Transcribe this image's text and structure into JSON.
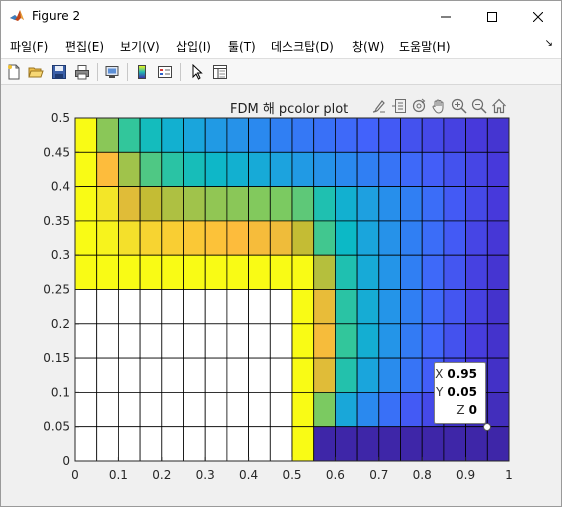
{
  "window": {
    "title": "Figure 2",
    "icon": "matlab-icon",
    "controls": [
      "minimize-icon",
      "maximize-icon",
      "close-icon"
    ]
  },
  "menubar": {
    "items": [
      {
        "label": "파일(F)"
      },
      {
        "label": "편집(E)"
      },
      {
        "label": "보기(V)"
      },
      {
        "label": "삽입(I)"
      },
      {
        "label": "툴(T)"
      },
      {
        "label": "데스크탑(D)"
      },
      {
        "label": "창(W)"
      },
      {
        "label": "도움말(H)"
      }
    ],
    "overflow_icon": "menu-overflow-arrow-icon"
  },
  "toolbar": {
    "buttons": [
      "new-figure-icon",
      "open-file-icon",
      "save-icon",
      "print-icon",
      "link-plot-icon",
      "insert-colorbar-icon",
      "insert-legend-icon",
      "edit-plot-pointer-icon",
      "property-inspector-icon"
    ]
  },
  "axes": {
    "title": "FDM 해 pcolor plot",
    "toolbar": [
      "brush-icon",
      "data-tip-icon",
      "rotate-icon",
      "pan-icon",
      "zoom-in-icon",
      "zoom-out-icon",
      "home-icon"
    ]
  },
  "chart_data": {
    "type": "heatmap",
    "title": "FDM 해 pcolor plot",
    "xlabel": "",
    "ylabel": "",
    "xlim": [
      0,
      1
    ],
    "ylim": [
      0,
      0.5
    ],
    "xticks": [
      "0",
      "0.1",
      "0.2",
      "0.3",
      "0.4",
      "0.5",
      "0.6",
      "0.7",
      "0.8",
      "0.9",
      "1"
    ],
    "yticks": [
      "0",
      "0.05",
      "0.1",
      "0.15",
      "0.2",
      "0.25",
      "0.3",
      "0.35",
      "0.4",
      "0.45",
      "0.5"
    ],
    "grid_step": 0.05,
    "rows_description": "rows listed from top (y=0.45..0.5) to bottom (y=0..0.05); columns from x=0..0.05 to x=0.95..1; null = NaN (white)",
    "z": [
      [
        1.0,
        0.72,
        0.6,
        0.52,
        0.46,
        0.41,
        0.37,
        0.34,
        0.31,
        0.28,
        0.26,
        0.24,
        0.22,
        0.2,
        0.18,
        0.16,
        0.14,
        0.12,
        0.1,
        0.08
      ],
      [
        1.0,
        0.88,
        0.75,
        0.64,
        0.58,
        0.53,
        0.49,
        0.46,
        0.43,
        0.4,
        0.37,
        0.34,
        0.31,
        0.28,
        0.25,
        0.22,
        0.19,
        0.16,
        0.13,
        0.1
      ],
      [
        1.0,
        0.95,
        0.84,
        0.8,
        0.77,
        0.75,
        0.73,
        0.72,
        0.71,
        0.7,
        0.66,
        0.55,
        0.46,
        0.39,
        0.33,
        0.28,
        0.23,
        0.18,
        0.14,
        0.1
      ],
      [
        1.0,
        0.98,
        0.94,
        0.92,
        0.91,
        0.9,
        0.89,
        0.88,
        0.87,
        0.86,
        0.8,
        0.62,
        0.5,
        0.41,
        0.34,
        0.28,
        0.23,
        0.18,
        0.13,
        0.09
      ],
      [
        1.0,
        1.0,
        1.0,
        1.0,
        1.0,
        1.0,
        1.0,
        1.0,
        1.0,
        1.0,
        1.0,
        0.78,
        0.55,
        0.43,
        0.35,
        0.28,
        0.22,
        0.17,
        0.12,
        0.08
      ],
      [
        null,
        null,
        null,
        null,
        null,
        null,
        null,
        null,
        null,
        null,
        1.0,
        0.85,
        0.58,
        0.44,
        0.35,
        0.28,
        0.22,
        0.17,
        0.12,
        0.07
      ],
      [
        null,
        null,
        null,
        null,
        null,
        null,
        null,
        null,
        null,
        null,
        1.0,
        0.87,
        0.6,
        0.45,
        0.35,
        0.27,
        0.21,
        0.16,
        0.11,
        0.07
      ],
      [
        null,
        null,
        null,
        null,
        null,
        null,
        null,
        null,
        null,
        null,
        1.0,
        0.84,
        0.56,
        0.41,
        0.32,
        0.25,
        0.19,
        0.14,
        0.1,
        0.06
      ],
      [
        null,
        null,
        null,
        null,
        null,
        null,
        null,
        null,
        null,
        null,
        1.0,
        0.7,
        0.42,
        0.31,
        0.24,
        0.18,
        0.14,
        0.1,
        0.07,
        0.04
      ],
      [
        null,
        null,
        null,
        null,
        null,
        null,
        null,
        null,
        null,
        null,
        1.0,
        0.0,
        0.0,
        0.0,
        0.0,
        0.0,
        0.0,
        0.0,
        0.0,
        0.0
      ]
    ],
    "colormap": "parula",
    "clim": [
      0,
      1
    ]
  },
  "datatip": {
    "x_label": "X",
    "x_value": "0.95",
    "y_label": "Y",
    "y_value": "0.05",
    "z_label": "Z",
    "z_value": "0"
  }
}
